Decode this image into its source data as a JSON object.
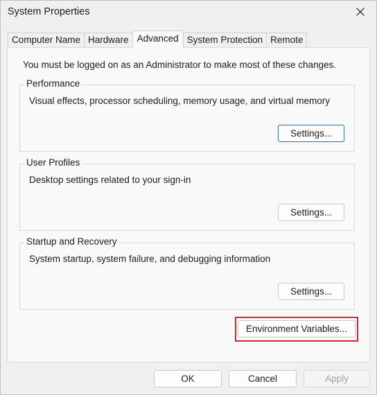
{
  "window": {
    "title": "System Properties",
    "close_icon": "close-icon"
  },
  "tabs": [
    {
      "label": "Computer Name",
      "active": false
    },
    {
      "label": "Hardware",
      "active": false
    },
    {
      "label": "Advanced",
      "active": true
    },
    {
      "label": "System Protection",
      "active": false
    },
    {
      "label": "Remote",
      "active": false
    }
  ],
  "advanced": {
    "admin_note": "You must be logged on as an Administrator to make most of these changes.",
    "performance": {
      "label": "Performance",
      "description": "Visual effects, processor scheduling, memory usage, and virtual memory",
      "button": "Settings..."
    },
    "user_profiles": {
      "label": "User Profiles",
      "description": "Desktop settings related to your sign-in",
      "button": "Settings..."
    },
    "startup_recovery": {
      "label": "Startup and Recovery",
      "description": "System startup, system failure, and debugging information",
      "button": "Settings..."
    },
    "environment_button": "Environment Variables...",
    "highlight_color": "#d6262d"
  },
  "footer": {
    "ok": "OK",
    "cancel": "Cancel",
    "apply": "Apply"
  }
}
